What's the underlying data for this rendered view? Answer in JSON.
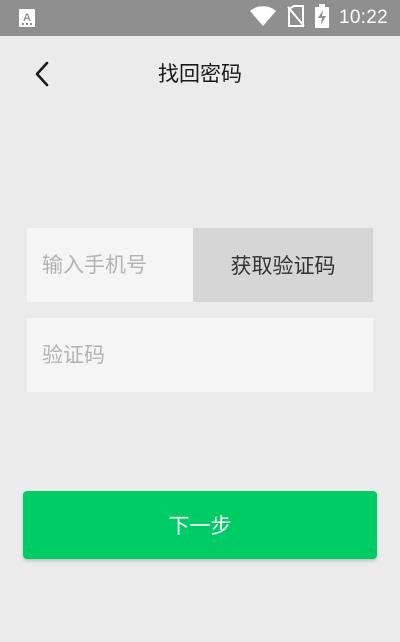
{
  "status_bar": {
    "time": "10:22",
    "icons": [
      "keyboard-a-icon",
      "wifi-icon",
      "no-sim-icon",
      "battery-charging-icon"
    ]
  },
  "header": {
    "title": "找回密码",
    "back_icon": "chevron-left-icon"
  },
  "form": {
    "phone_placeholder": "输入手机号",
    "phone_value": "",
    "get_code_label": "获取验证码",
    "code_placeholder": "验证码",
    "code_value": ""
  },
  "actions": {
    "next_label": "下一步"
  },
  "colors": {
    "status_bar": "#8f8f8f",
    "background": "#ebebeb",
    "input_bg": "#f5f5f5",
    "code_button_bg": "#d6d6d6",
    "primary": "#00cc66"
  }
}
